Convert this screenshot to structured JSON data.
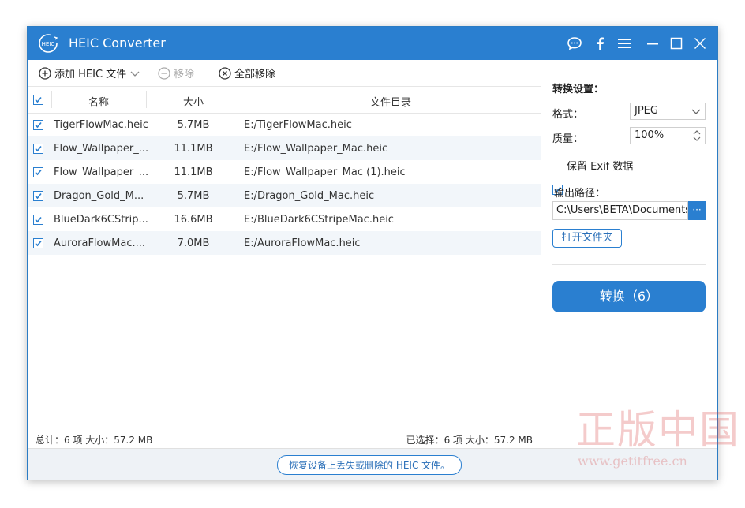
{
  "window": {
    "logo_text": "HEIC",
    "title": "HEIC Converter"
  },
  "toolbar": {
    "add_label": "添加 HEIC 文件",
    "remove_label": "移除",
    "remove_all_label": "全部移除"
  },
  "table": {
    "columns": [
      "名称",
      "大小",
      "文件目录"
    ],
    "rows": [
      {
        "name": "TigerFlowMac.heic",
        "size": "5.7MB",
        "dir": "E:/TigerFlowMac.heic"
      },
      {
        "name": "Flow_Wallpaper_...",
        "size": "11.1MB",
        "dir": "E:/Flow_Wallpaper_Mac.heic"
      },
      {
        "name": "Flow_Wallpaper_...",
        "size": "11.1MB",
        "dir": "E:/Flow_Wallpaper_Mac (1).heic"
      },
      {
        "name": "Dragon_Gold_M...",
        "size": "5.7MB",
        "dir": "E:/Dragon_Gold_Mac.heic"
      },
      {
        "name": "BlueDark6CStrip...",
        "size": "16.6MB",
        "dir": "E:/BlueDark6CStripeMac.heic"
      },
      {
        "name": "AuroraFlowMac....",
        "size": "7.0MB",
        "dir": "E:/AuroraFlowMac.heic"
      }
    ]
  },
  "status": {
    "total": "总计：6 项 大小：57.2 MB",
    "selected": "已选择：6 项 大小：57.2 MB"
  },
  "footer": {
    "recover_link": "恢复设备上丢失或删除的 HEIC 文件。"
  },
  "settings": {
    "heading": "转换设置：",
    "format_label": "格式：",
    "format_value": "JPEG",
    "quality_label": "质量：",
    "quality_value": "100%",
    "keep_exif_label": "保留 Exif 数据",
    "output_label": "输出路径：",
    "output_path": "C:\\Users\\BETA\\Documents",
    "browse_label": "···",
    "open_folder_label": "打开文件夹",
    "convert_label": "转换（6）"
  },
  "watermark": {
    "line1": "正版中国",
    "line2": "www.getitfree.cn"
  },
  "colors": {
    "accent": "#2a7fd0",
    "row_alt": "#f2f6fa"
  }
}
